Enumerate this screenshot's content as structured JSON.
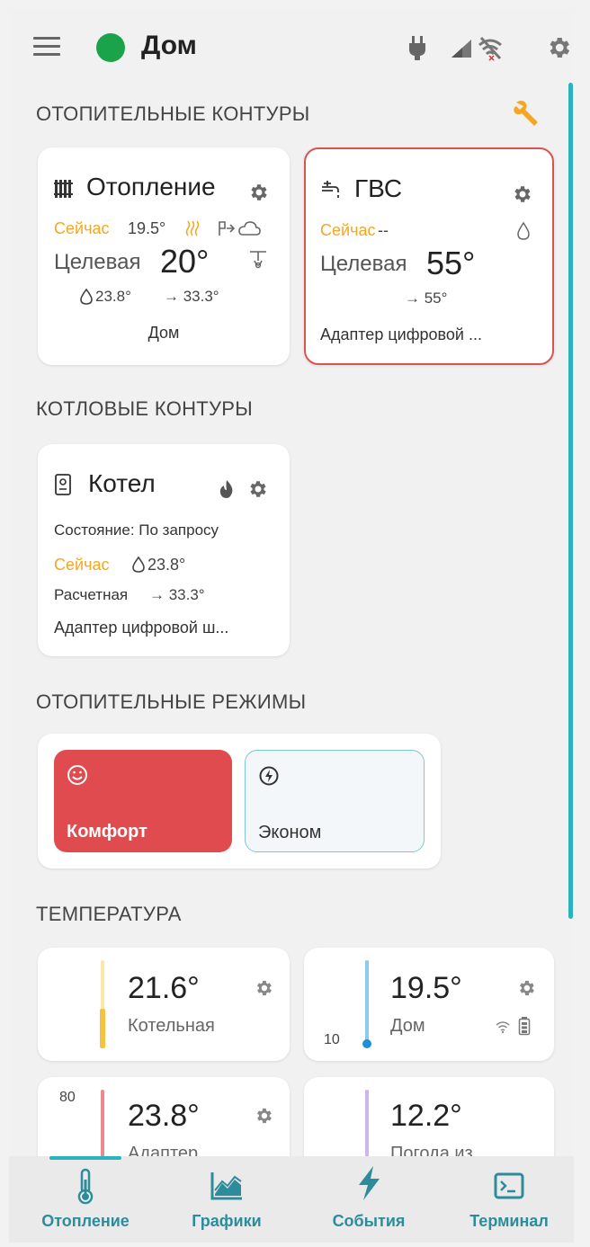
{
  "header": {
    "title": "Дом",
    "status_color": "#1aa34a",
    "icons": [
      "menu-icon",
      "plug-icon",
      "signal-icon",
      "wifi-off-icon",
      "gear-icon"
    ]
  },
  "sections": {
    "heating_circuits": "ОТОПИТЕЛЬНЫЕ КОНТУРЫ",
    "boiler_circuits": "КОТЛОВЫЕ КОНТУРЫ",
    "heating_modes": "ОТОПИТЕЛЬНЫЕ РЕЖИМЫ",
    "temperature": "ТЕМПЕРАТУРА"
  },
  "heating_card": {
    "title": "Отопление",
    "now_label": "Сейчас",
    "now_value": "19.5°",
    "target_label": "Целевая",
    "target_value": "20°",
    "supply_value": "23.8°",
    "arrow_value": "→ 33.3°",
    "location": "Дом"
  },
  "gvs_card": {
    "title": "ГВС",
    "now_label": "Сейчас",
    "now_value": "--",
    "target_label": "Целевая",
    "target_value": "55°",
    "arrow_value": "→ 55°",
    "source": "Адаптер цифровой ..."
  },
  "boiler_card": {
    "title": "Котел",
    "state": "Состояние: По запросу",
    "now_label": "Сейчас",
    "now_value": "23.8°",
    "calc_label": "Расчетная",
    "calc_value": "→ 33.3°",
    "source": "Адаптер цифровой ш..."
  },
  "modes": {
    "comfort": "Комфорт",
    "econom": "Эконом",
    "active": "Комфорт"
  },
  "sensors": [
    {
      "value": "21.6°",
      "name": "Котельная",
      "min": "",
      "color": "#f5c242"
    },
    {
      "value": "19.5°",
      "name": "Дом",
      "min": "10",
      "color": "#6ab8e6"
    },
    {
      "value": "23.8°",
      "name": "Адаптер",
      "max": "80",
      "color": "#e88a90"
    },
    {
      "value": "12.2°",
      "name": "Погода из",
      "min": "",
      "color": "#cdb5ec"
    }
  ],
  "nav": {
    "items": [
      "Отопление",
      "Графики",
      "События",
      "Терминал"
    ],
    "active": "Отопление"
  },
  "colors": {
    "accent": "#2bb3bd",
    "orange": "#f5a623",
    "comfort_red": "#e04b50",
    "gvs_border": "#d9534f"
  }
}
